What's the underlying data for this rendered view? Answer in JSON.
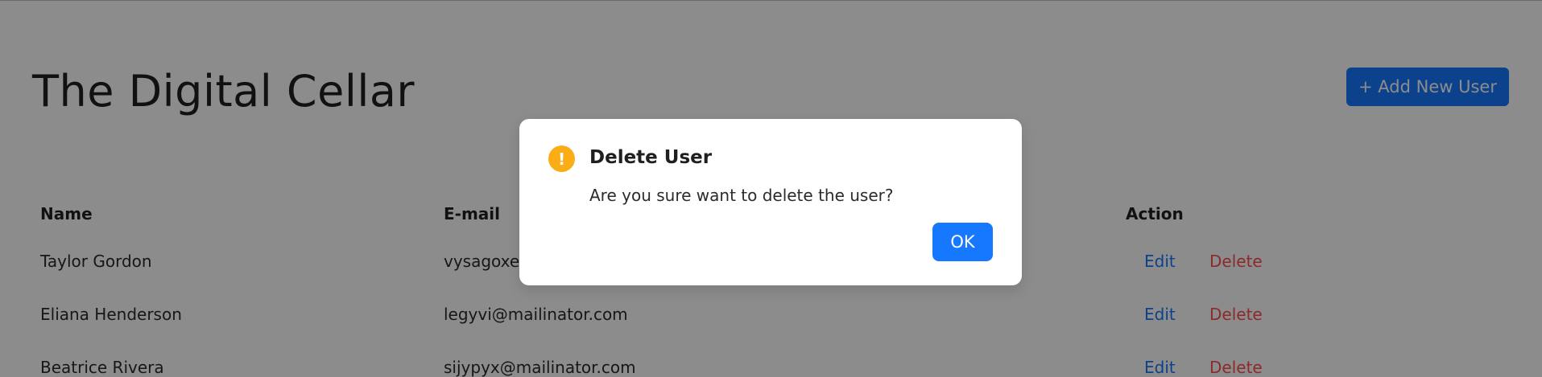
{
  "header": {
    "title": "The Digital Cellar",
    "add_user_label": "+ Add New User"
  },
  "table": {
    "columns": [
      "Name",
      "E-mail",
      "Action"
    ],
    "rows": [
      {
        "name": "Taylor Gordon",
        "email": "vysagoxed",
        "edit": "Edit",
        "delete": "Delete"
      },
      {
        "name": "Eliana Henderson",
        "email": "legyvi@mailinator.com",
        "edit": "Edit",
        "delete": "Delete"
      },
      {
        "name": "Beatrice Rivera",
        "email": "sijypyx@mailinator.com",
        "edit": "Edit",
        "delete": "Delete"
      }
    ]
  },
  "modal": {
    "icon": "exclamation-icon",
    "icon_glyph": "!",
    "title": "Delete User",
    "message": "Are you sure want to delete the user?",
    "ok_label": "OK"
  },
  "colors": {
    "primary": "#1677ff",
    "danger": "#ff4d4f",
    "warning": "#faad14",
    "overlay": "rgba(0,0,0,0.45)"
  }
}
